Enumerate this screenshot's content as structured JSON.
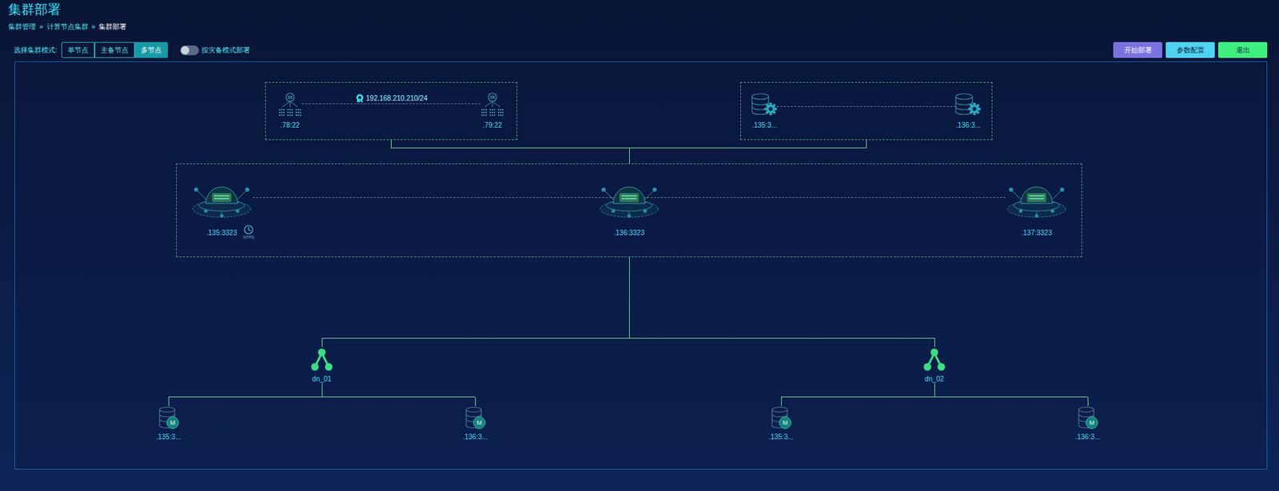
{
  "page": {
    "title": "集群部署"
  },
  "breadcrumb": {
    "items": [
      "集群管理",
      "计算节点集群",
      "集群部署"
    ],
    "separator": "»"
  },
  "toolbar": {
    "mode_label": "选择集群模式:",
    "modes": [
      {
        "label": "单节点",
        "selected": false
      },
      {
        "label": "主备节点",
        "selected": false
      },
      {
        "label": "多节点",
        "selected": true
      }
    ],
    "disaster_mode": {
      "label": "按灾备模式部署",
      "on": false
    },
    "buttons": [
      {
        "label": "开始部署",
        "color": "#7b72e0"
      },
      {
        "label": "参数配置",
        "color": "#4fd3f0"
      },
      {
        "label": "退出",
        "color": "#3ef07d"
      }
    ]
  },
  "diagram": {
    "load_balancers": {
      "vip": "192.168.210.210/24",
      "nodes": [
        {
          "label": ".78:22",
          "badge": "OS"
        },
        {
          "label": ".79:22",
          "badge": "OS"
        }
      ]
    },
    "managers": {
      "nodes": [
        ".135:3...",
        ".136:3..."
      ]
    },
    "compute_nodes": {
      "ntp_label": "NTPD",
      "nodes": [
        {
          "label": ".135:3323",
          "ntp": true
        },
        {
          "label": ".136:3323",
          "ntp": false
        },
        {
          "label": ".137:3323",
          "ntp": false
        }
      ]
    },
    "data_node_groups": [
      {
        "name": "dn_01",
        "nodes": [
          {
            "label": ".135:3...",
            "role": "M"
          },
          {
            "label": ".136:3...",
            "role": "M"
          }
        ]
      },
      {
        "name": "dn_02",
        "nodes": [
          {
            "label": ".135:3...",
            "role": "M"
          },
          {
            "label": ".136:3...",
            "role": "M"
          }
        ]
      }
    ]
  }
}
